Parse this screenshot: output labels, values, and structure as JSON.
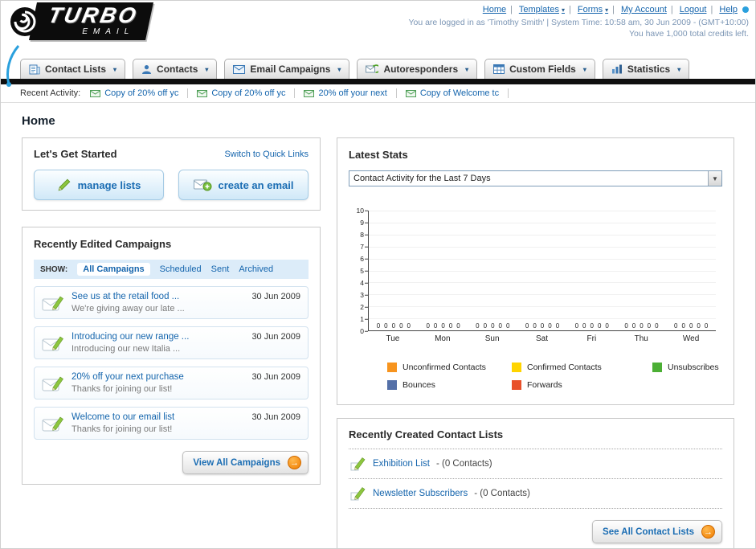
{
  "header": {
    "logo": {
      "title": "TURBO",
      "subtitle": "EMAIL"
    },
    "nav": [
      {
        "label": "Home"
      },
      {
        "label": "Templates"
      },
      {
        "label": "Forms"
      },
      {
        "label": "My Account"
      },
      {
        "label": "Logout"
      },
      {
        "label": "Help"
      }
    ],
    "session_line": "You are logged in as 'Timothy Smith' | System Time: 10:58 am, 30 Jun 2009 - (GMT+10:00)",
    "credits_line": "You have 1,000 total credits left."
  },
  "nav_tabs": [
    {
      "label": "Contact Lists",
      "icon": "contact-lists-icon"
    },
    {
      "label": "Contacts",
      "icon": "contacts-icon"
    },
    {
      "label": "Email Campaigns",
      "icon": "email-campaigns-icon"
    },
    {
      "label": "Autoresponders",
      "icon": "autoresponders-icon"
    },
    {
      "label": "Custom Fields",
      "icon": "custom-fields-icon"
    },
    {
      "label": "Statistics",
      "icon": "statistics-icon"
    }
  ],
  "recent_activity": {
    "label": "Recent Activity:",
    "items": [
      {
        "label": "Copy of 20% off yc"
      },
      {
        "label": "Copy of 20% off yc"
      },
      {
        "label": "20% off your next"
      },
      {
        "label": "Copy of Welcome tc"
      }
    ]
  },
  "page": {
    "title": "Home"
  },
  "get_started": {
    "title": "Let's Get Started",
    "switch_link": "Switch to Quick Links",
    "manage_lists_button": "manage lists",
    "create_email_button": "create an email"
  },
  "campaigns": {
    "title": "Recently Edited Campaigns",
    "show_label": "SHOW:",
    "filters": [
      {
        "label": "All Campaigns",
        "active": true
      },
      {
        "label": "Scheduled",
        "active": false
      },
      {
        "label": "Sent",
        "active": false
      },
      {
        "label": "Archived",
        "active": false
      }
    ],
    "items": [
      {
        "title": "See us at the retail food ...",
        "subtitle": "We're giving away our late ...",
        "date": "30 Jun 2009"
      },
      {
        "title": "Introducing our new range ...",
        "subtitle": "Introducing our new Italia ...",
        "date": "30 Jun 2009"
      },
      {
        "title": "20% off your next purchase",
        "subtitle": "Thanks for joining our list!",
        "date": "30 Jun 2009"
      },
      {
        "title": "Welcome to our email list",
        "subtitle": "Thanks for joining our list!",
        "date": "30 Jun 2009"
      }
    ],
    "view_all_button": "View All Campaigns"
  },
  "latest_stats": {
    "title": "Latest Stats",
    "dropdown_value": "Contact Activity for the Last 7 Days",
    "chart_data": {
      "type": "bar",
      "title": "Contact Activity for the Last 7 Days",
      "categories": [
        "Tue",
        "Mon",
        "Sun",
        "Sat",
        "Fri",
        "Thu",
        "Wed"
      ],
      "series": [
        {
          "name": "Unconfirmed Contacts",
          "color": "#f7941e",
          "values": [
            0,
            0,
            0,
            0,
            0,
            0,
            0
          ]
        },
        {
          "name": "Confirmed Contacts",
          "color": "#ffd400",
          "values": [
            0,
            0,
            0,
            0,
            0,
            0,
            0
          ]
        },
        {
          "name": "Unsubscribes",
          "color": "#4caf35",
          "values": [
            0,
            0,
            0,
            0,
            0,
            0,
            0
          ]
        },
        {
          "name": "Bounces",
          "color": "#5470a8",
          "values": [
            0,
            0,
            0,
            0,
            0,
            0,
            0
          ]
        },
        {
          "name": "Forwards",
          "color": "#e8502a",
          "values": [
            0,
            0,
            0,
            0,
            0,
            0,
            0
          ]
        }
      ],
      "ylim": [
        0,
        10
      ],
      "ytick_step": 1,
      "grid": false,
      "value_labels_shown": true,
      "legend_position": "bottom"
    }
  },
  "contact_lists": {
    "title": "Recently Created Contact Lists",
    "items": [
      {
        "name": "Exhibition List",
        "detail": "- (0 Contacts)"
      },
      {
        "name": "Newsletter Subscribers",
        "detail": "- (0 Contacts)"
      }
    ],
    "see_all_button": "See All Contact Lists"
  }
}
